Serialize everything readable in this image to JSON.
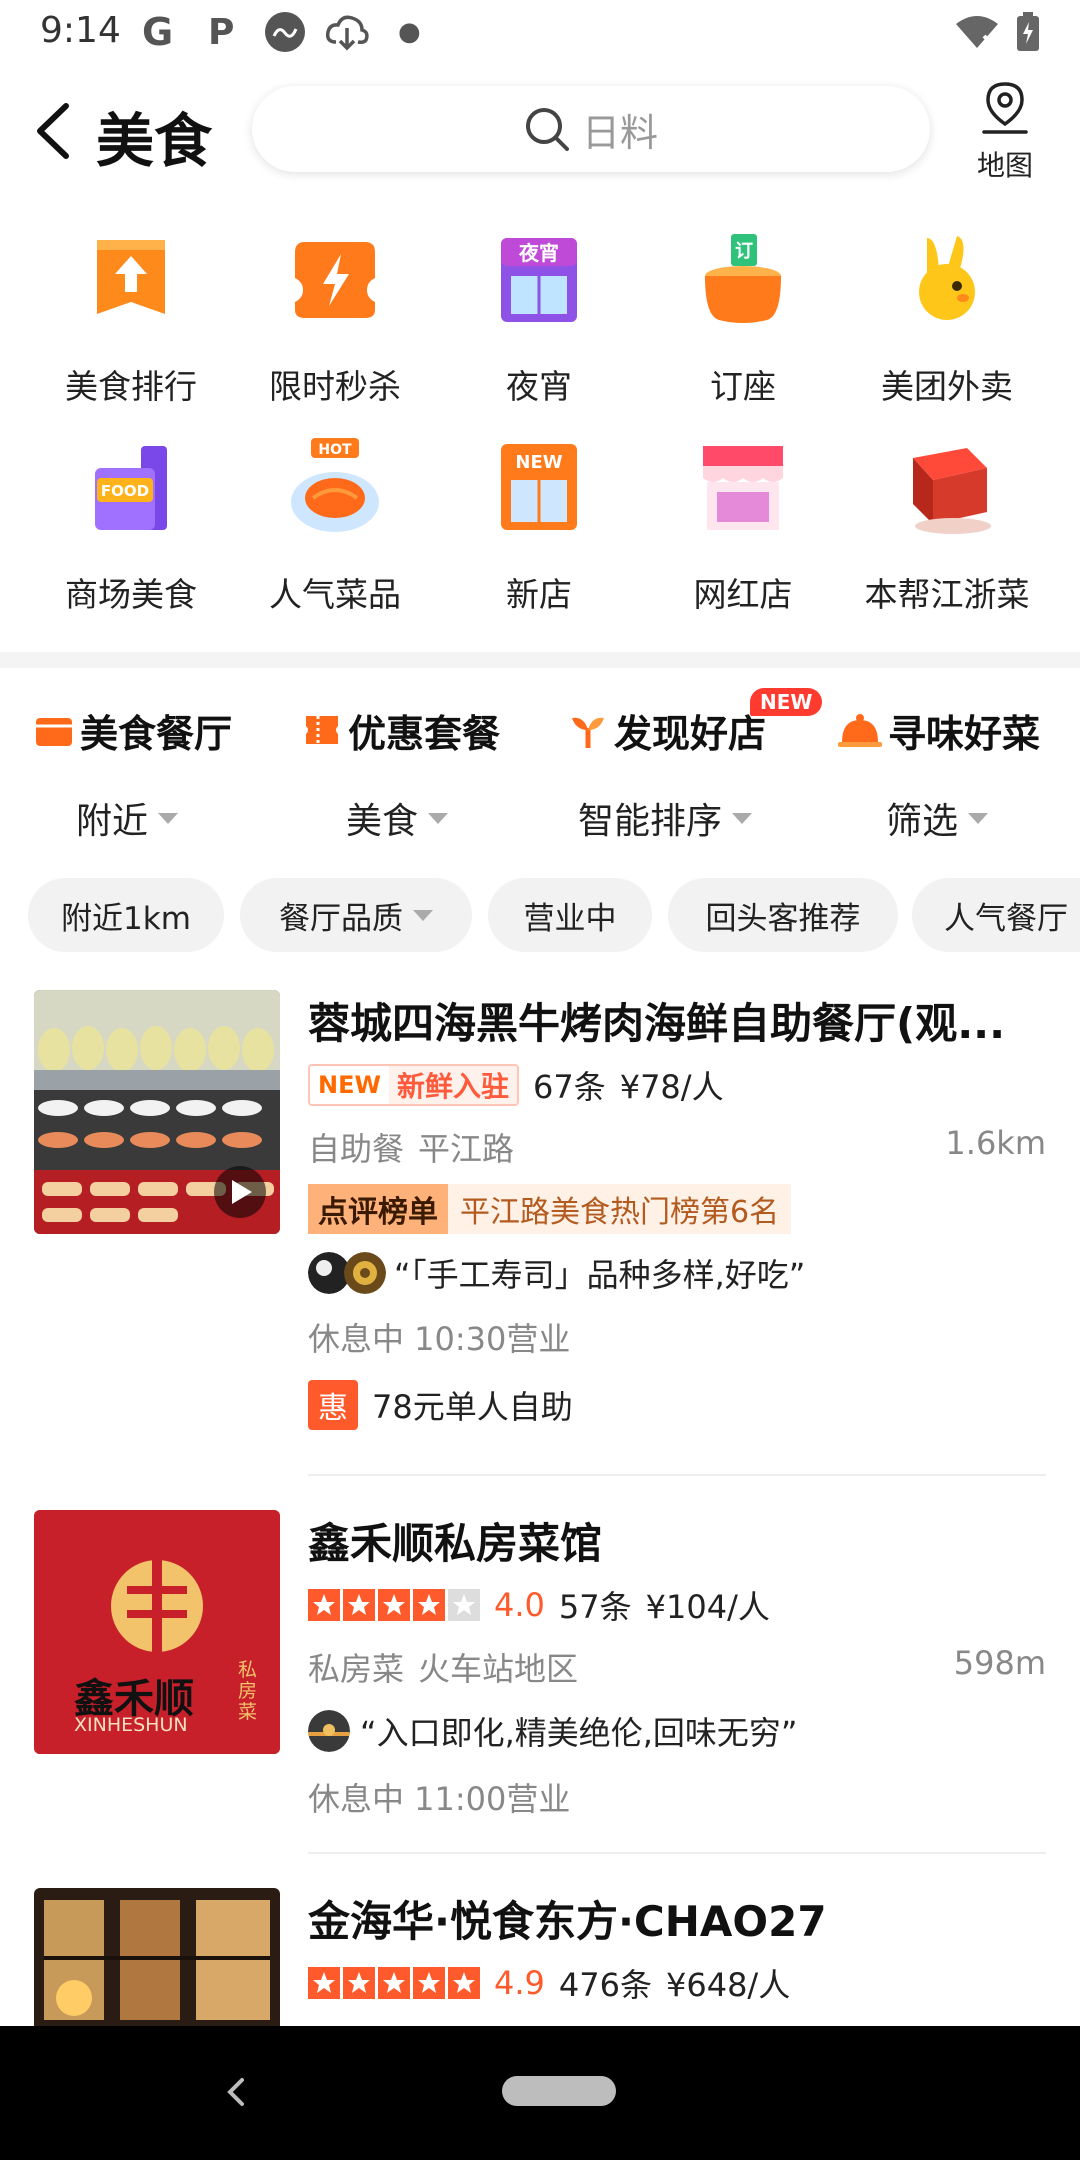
{
  "status_bar": {
    "time": "9:14",
    "icons": [
      "google-icon",
      "p-icon",
      "car-icon",
      "cloud-download-icon",
      "dot-icon",
      "wifi-icon",
      "battery-icon"
    ]
  },
  "header": {
    "title": "美食",
    "search_placeholder": "日料",
    "map_label": "地图"
  },
  "categories": [
    {
      "label": "美食排行",
      "icon": "ranking-icon"
    },
    {
      "label": "限时秒杀",
      "icon": "flash-sale-icon"
    },
    {
      "label": "夜宵",
      "icon": "night-snack-icon"
    },
    {
      "label": "订座",
      "icon": "reserve-table-icon"
    },
    {
      "label": "美团外卖",
      "icon": "takeout-icon"
    },
    {
      "label": "商场美食",
      "icon": "mall-food-icon"
    },
    {
      "label": "人气菜品",
      "icon": "hot-dish-icon"
    },
    {
      "label": "新店",
      "icon": "new-store-icon"
    },
    {
      "label": "网红店",
      "icon": "influencer-store-icon"
    },
    {
      "label": "本帮江浙菜",
      "icon": "jiangzhe-cuisine-icon"
    }
  ],
  "tabs": [
    {
      "label": "美食餐厅",
      "active": true
    },
    {
      "label": "优惠套餐",
      "active": false
    },
    {
      "label": "发现好店",
      "active": false,
      "badge": "NEW"
    },
    {
      "label": "寻味好菜",
      "active": false
    }
  ],
  "filters": [
    "附近",
    "美食",
    "智能排序",
    "筛选"
  ],
  "chips": [
    {
      "label": "附近1km",
      "dropdown": false
    },
    {
      "label": "餐厅品质",
      "dropdown": true
    },
    {
      "label": "营业中",
      "dropdown": false
    },
    {
      "label": "回头客推荐",
      "dropdown": false
    },
    {
      "label": "人气餐厅",
      "dropdown": false
    }
  ],
  "restaurants": [
    {
      "name": "蓉城四海黑牛烤肉海鲜自助餐厅(观...",
      "new_tag_a": "NEW",
      "new_tag_b": "新鲜入驻",
      "reviews": "67条",
      "price": "¥78/人",
      "category": "自助餐",
      "area": "平江路",
      "distance": "1.6km",
      "rank_tag_a": "点评榜单",
      "rank_tag_b": "平江路美食热门榜第6名",
      "quote": "“「手工寿司」品种多样,好吃”",
      "hours": "休息中 10:30营业",
      "deal_icon": "惠",
      "deal": "78元单人自助"
    },
    {
      "name": "鑫禾顺私房菜馆",
      "rating": "4.0",
      "stars": 4,
      "reviews": "57条",
      "price": "¥104/人",
      "category": "私房菜",
      "area": "火车站地区",
      "distance": "598m",
      "quote": "“入口即化,精美绝伦,回味无穷”",
      "hours": "休息中 11:00营业",
      "logo_cn": "鑫禾顺",
      "logo_en": "XINHESHUN",
      "logo_side": "私房菜"
    },
    {
      "name": "金海华·悦食东方·CHAO27",
      "rating": "4.9",
      "stars": 5,
      "reviews": "476条",
      "price": "¥648/人"
    }
  ],
  "colors": {
    "accent": "#ff5a2c",
    "accent_light": "#ff9b3c",
    "muted": "#888888"
  }
}
